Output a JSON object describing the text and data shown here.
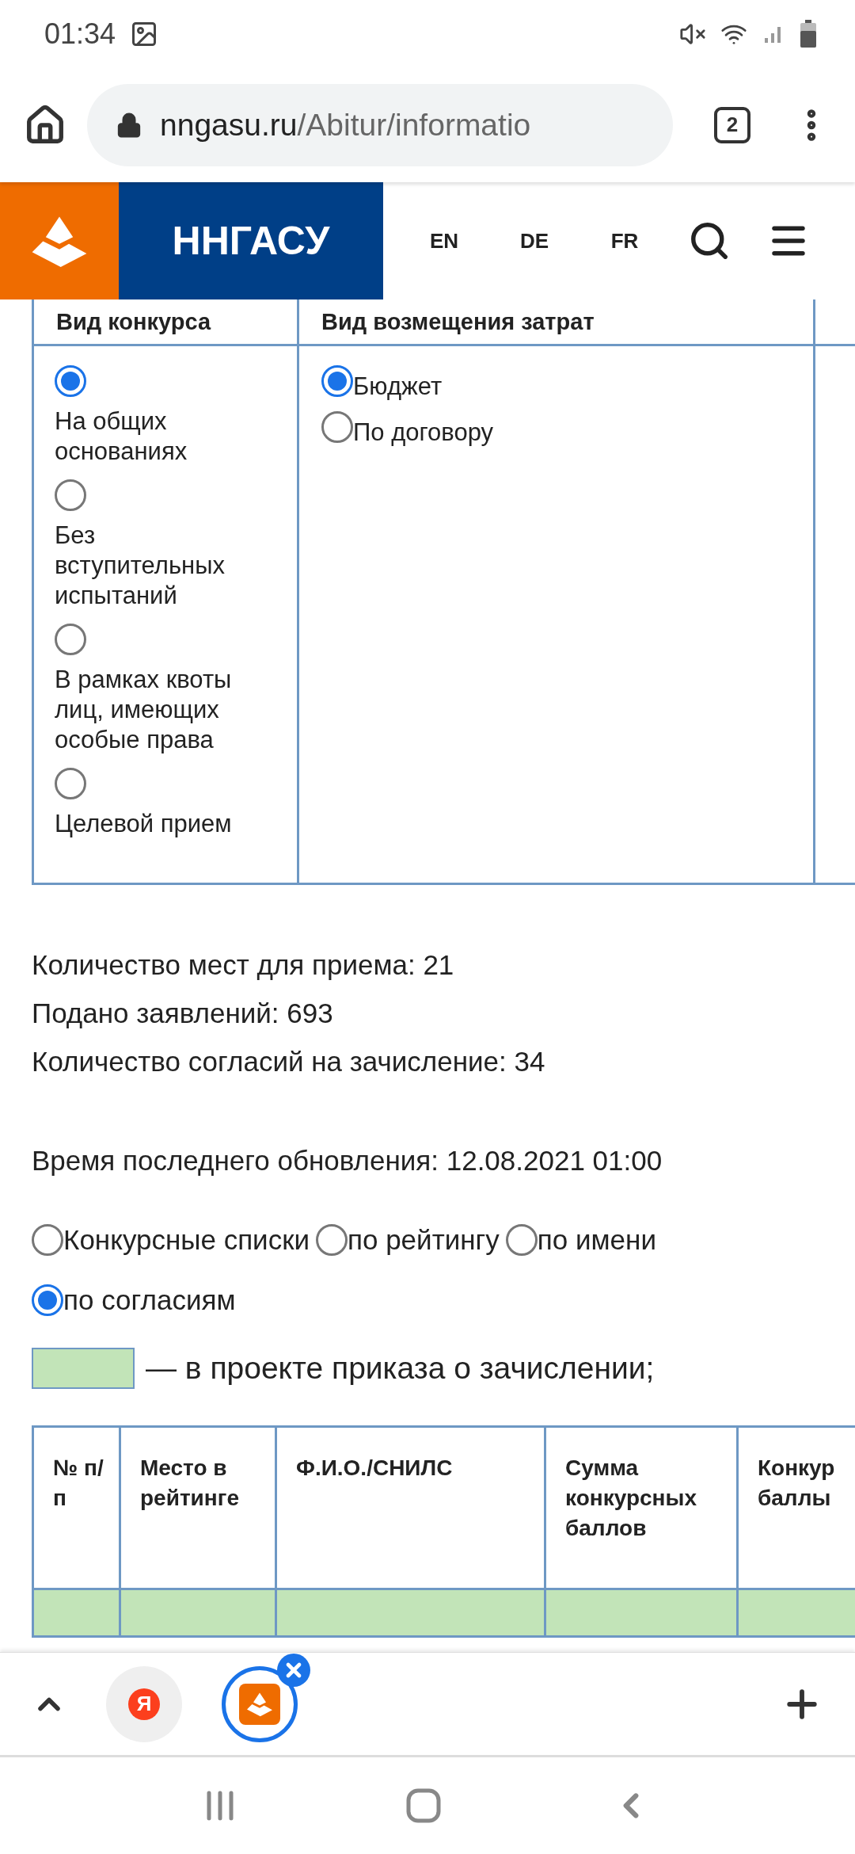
{
  "status_bar": {
    "time": "01:34"
  },
  "browser": {
    "url_host": "nngasu.ru",
    "url_path": "/Abitur/informatio",
    "tab_count": "2"
  },
  "site_header": {
    "logo_text": "ННГАСУ",
    "languages": [
      "EN",
      "DE",
      "FR"
    ]
  },
  "filter_table": {
    "columns": [
      "Вид конкурса",
      "Вид возмещения затрат"
    ],
    "competition_types": [
      {
        "label": "На общих основаниях",
        "selected": true
      },
      {
        "label": "Без вступительных испытаний",
        "selected": false
      },
      {
        "label": "В рамках квоты лиц, имеющих особые права",
        "selected": false
      },
      {
        "label": "Целевой прием",
        "selected": false
      }
    ],
    "funding_types": [
      {
        "label": "Бюджет",
        "selected": true
      },
      {
        "label": "По договору",
        "selected": false
      }
    ]
  },
  "stats": [
    "Количество мест для приема: 21",
    "Подано заявлений: 693",
    "Количество согласий на зачисление: 34"
  ],
  "updated": "Время последнего обновления: 12.08.2021 01:00",
  "sort_options": [
    {
      "label": "Конкурсные списки",
      "selected": false
    },
    {
      "label": "по рейтингу",
      "selected": false
    },
    {
      "label": "по имени",
      "selected": false
    },
    {
      "label": "по согласиям",
      "selected": true
    }
  ],
  "legend": {
    "color": "#c2e4b8",
    "text": "— в проекте приказа о зачислении;"
  },
  "rating_table": {
    "columns": [
      "№ п/п",
      "Место в рейтинге",
      "Ф.И.О./СНИЛС",
      "Сумма конкурсных баллов",
      "Конкур баллы"
    ],
    "rows": [
      {
        "in_order_draft": true
      }
    ]
  },
  "bottom_bar": {
    "tabs": [
      {
        "kind": "yandex",
        "label": "Я",
        "selected": false
      },
      {
        "kind": "site",
        "selected": true
      }
    ]
  }
}
